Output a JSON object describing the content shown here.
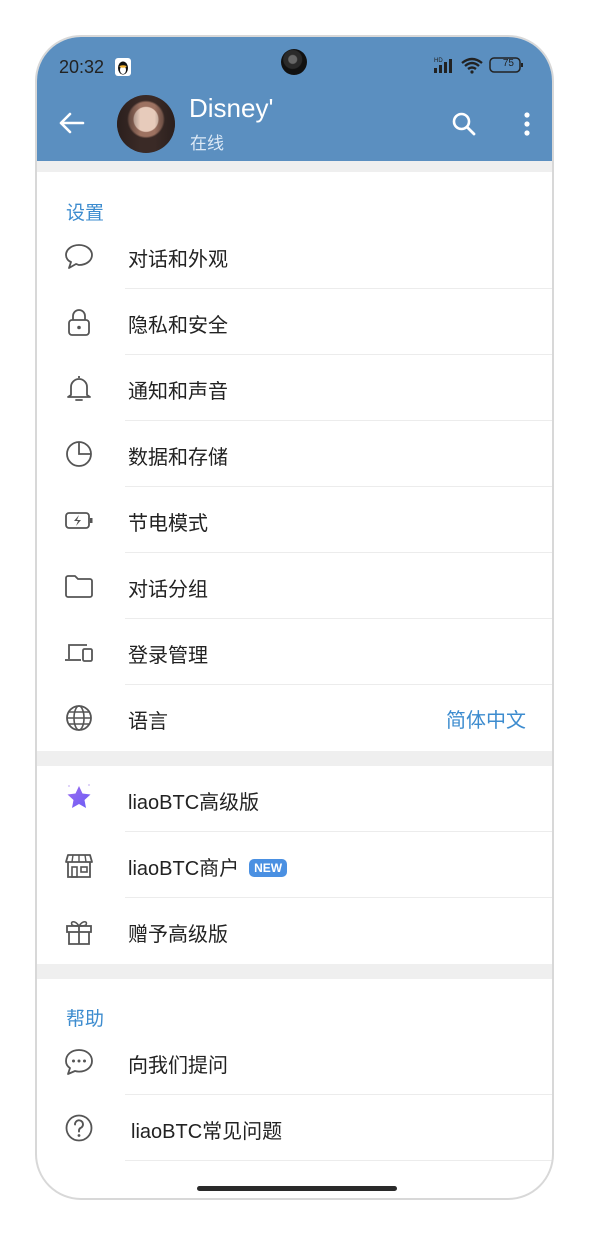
{
  "status_bar": {
    "time": "20:32",
    "battery": "75"
  },
  "header": {
    "title": "Disney'",
    "subtitle": "在线"
  },
  "settings_section": {
    "title": "设置",
    "items": [
      {
        "label": "对话和外观",
        "icon": "chat-bubble-icon"
      },
      {
        "label": "隐私和安全",
        "icon": "lock-icon"
      },
      {
        "label": "通知和声音",
        "icon": "bell-icon"
      },
      {
        "label": "数据和存储",
        "icon": "pie-chart-icon"
      },
      {
        "label": "节电模式",
        "icon": "battery-icon"
      },
      {
        "label": "对话分组",
        "icon": "folder-icon"
      },
      {
        "label": "登录管理",
        "icon": "devices-icon"
      },
      {
        "label": "语言",
        "icon": "globe-icon",
        "value": "简体中文"
      }
    ]
  },
  "premium_section": {
    "items": [
      {
        "label": "liaoBTC高级版",
        "icon": "star-icon"
      },
      {
        "label": "liaoBTC商户",
        "icon": "shop-icon",
        "badge": "NEW"
      },
      {
        "label": "赠予高级版",
        "icon": "gift-icon"
      }
    ]
  },
  "help_section": {
    "title": "帮助",
    "items": [
      {
        "label": "向我们提问",
        "icon": "chat-dots-icon"
      },
      {
        "label": "liaoBTC常见问题",
        "icon": "question-icon"
      }
    ]
  },
  "colors": {
    "header": "#5b8fc0",
    "accent": "#3d8ccf",
    "badge": "#4a90e2"
  }
}
